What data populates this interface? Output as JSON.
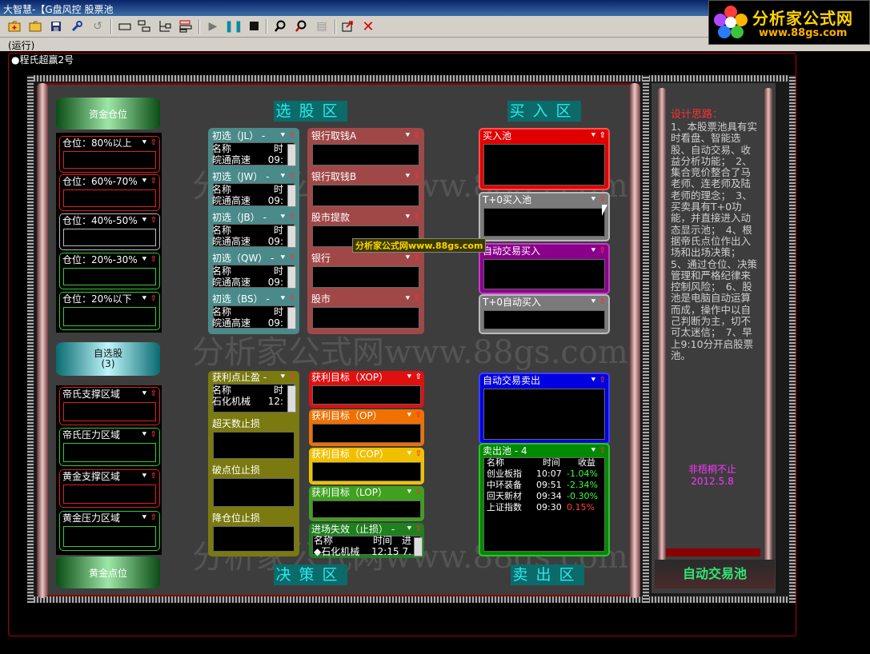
{
  "window": {
    "title": "大智慧-【G盘风控  股票池",
    "run_status": "(运行)"
  },
  "logo": {
    "brand": "分析家公式网",
    "url": "www.88gs.com"
  },
  "workspace": {
    "label": "●程氏超赢2号"
  },
  "watermark": {
    "text": "分析家公式网www.88gs.com",
    "small": "分析家公式网www.88gs.com"
  },
  "sections": {
    "select": "选股区",
    "buy": "买入区",
    "decide": "决策区",
    "sell": "卖出区"
  },
  "left": {
    "fund_position": "资金仓位",
    "positions": [
      "仓位：80%以上",
      "仓位：60%-70%",
      "仓位：40%-50%",
      "仓位：20%-30%",
      "仓位：20%以下"
    ],
    "watchlist": {
      "label": "自选股",
      "count": "(3)"
    },
    "zones": [
      "帝氏支撑区域",
      "帝氏压力区域",
      "黄金支撑区域",
      "黄金压力区域"
    ],
    "gold_point": "黄金点位"
  },
  "screens": [
    {
      "title": "初选（JL） -",
      "col1": "名称",
      "col2": "时",
      "row": "皖通高速",
      "time": "09:"
    },
    {
      "title": "初选（JW） -",
      "col1": "名称",
      "col2": "时",
      "row": "皖通高速",
      "time": "09:"
    },
    {
      "title": "初选（JB） -",
      "col1": "名称",
      "col2": "时",
      "row": "皖通高速",
      "time": "09:"
    },
    {
      "title": "初选（QW） -",
      "col1": "名称",
      "col2": "时",
      "row": "皖通高速",
      "time": "09:"
    },
    {
      "title": "初选（BS） -",
      "col1": "名称",
      "col2": "时",
      "row": "皖通高速",
      "time": "09:"
    }
  ],
  "sectors": [
    "银行取钱A",
    "银行取钱B",
    "股市提款",
    "银行",
    "股市"
  ],
  "buy": [
    "买入池",
    "T+0买入池",
    "自动交易买入",
    "T+0自动买入"
  ],
  "decide": [
    {
      "title": "获利点止盈 -",
      "col1": "名称",
      "col2": "时",
      "row": "石化机械",
      "time": "12:"
    },
    {
      "title": "超天数止损"
    },
    {
      "title": "破点位止损"
    },
    {
      "title": "降仓位止损"
    }
  ],
  "targets": [
    "获利目标（XOP）",
    "获利目标（OP）",
    "获利目标（COP）",
    "获利目标（LOP）"
  ],
  "exit": {
    "title": "进场失效（止损） -",
    "col1": "名称",
    "col2": "时间",
    "col3": "进",
    "row": "◆石化机械",
    "time": "12:15",
    "val": "7."
  },
  "auto_sell": "自动交易卖出",
  "sell_pool": {
    "title": "卖出池 - 4",
    "headers": [
      "名称",
      "时间",
      "收益"
    ],
    "rows": [
      {
        "name": "创业板指",
        "time": "10:07",
        "gain": "-1.04%",
        "sign": "neg"
      },
      {
        "name": "中环装备",
        "time": "09:51",
        "gain": "-2.34%",
        "sign": "neg"
      },
      {
        "name": "回天新材",
        "time": "09:34",
        "gain": "-0.30%",
        "sign": "neg"
      },
      {
        "name": "上证指数",
        "time": "09:30",
        "gain": "0.15%",
        "sign": "pos"
      }
    ]
  },
  "design": {
    "title": "设计思路：",
    "body": "1、本股票池具有实时看盘、智能选股、自动交易、收益分析功能；　2、集合竞价整合了马老师、连老师及陆老师的理念；　3、买卖具有T+0功能，并直接进入动态显示池；　4、根据帝氏点位作出入场和出场决策；　5、通过仓位、决策管理和严格纪律来控制风险；　6、股池是电脑自动运算而成，操作中以自己判断为主，切不可太迷信；　7、早上9:10分开启股票池。",
    "author": "非梧桐不止",
    "date": "2012.5.8",
    "auto_pool": "自动交易池"
  },
  "colors": {
    "select_box": "#4a8a8a",
    "sector_box": "#a04848",
    "buy_red": "#e00000",
    "buy_purple": "#8a008a",
    "buy_gray": "#7a7a7a",
    "decide_olive": "#7a7a10",
    "sell_blue": "#0000e0",
    "sell_green": "#008a00"
  }
}
